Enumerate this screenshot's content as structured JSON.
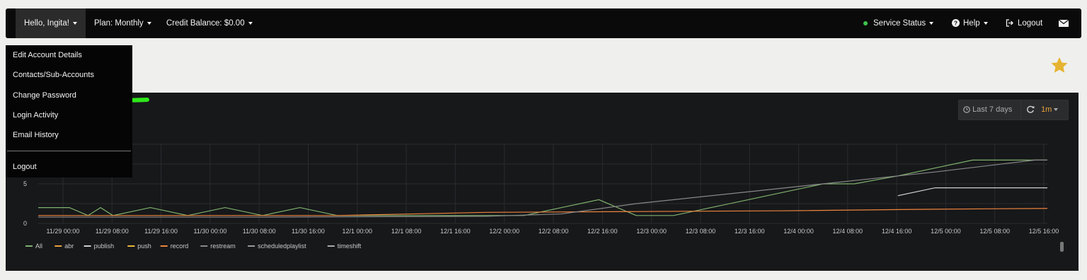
{
  "navbar": {
    "greeting": "Hello, Ingita!",
    "plan": "Plan: Monthly",
    "credit": "Credit Balance: $0.00",
    "service_status": "Service Status",
    "help": "Help",
    "logout": "Logout"
  },
  "account_menu": {
    "items": [
      "Edit Account Details",
      "Contacts/Sub-Accounts",
      "Change Password",
      "Login Activity",
      "Email History"
    ],
    "logout": "Logout"
  },
  "chart_toolbar": {
    "range": "Last 7 days",
    "refresh_interval": "1m"
  },
  "colors": {
    "accent_orange": "#e8a33a",
    "status_green": "#3fc54b",
    "annotation_arrow": "#2ee81a",
    "star": "#e6b432"
  },
  "chart_data": {
    "type": "line",
    "y_ticks": [
      "0",
      "5"
    ],
    "x_ticks": [
      "11/29 00:00",
      "11/29 08:00",
      "11/29 16:00",
      "11/30 00:00",
      "11/30 08:00",
      "11/30 16:00",
      "12/1 00:00",
      "12/1 08:00",
      "12/1 16:00",
      "12/2 00:00",
      "12/2 08:00",
      "12/2 16:00",
      "12/3 00:00",
      "12/3 08:00",
      "12/3 16:00",
      "12/4 00:00",
      "12/4 08:00",
      "12/4 16:00",
      "12/5 00:00",
      "12/5 08:00",
      "12/5 16:00"
    ],
    "legend": [
      {
        "name": "All",
        "color": "#7eb26d"
      },
      {
        "name": "abr",
        "color": "#e8a33a"
      },
      {
        "name": "publish",
        "color": "#cfcfcf"
      },
      {
        "name": "push",
        "color": "#eab839"
      },
      {
        "name": "record",
        "color": "#ef843c"
      },
      {
        "name": "restream",
        "color": "#888888"
      },
      {
        "name": "scheduledplaylist",
        "color": "#999999"
      },
      {
        "name": "timeshift",
        "color": "#aaaaaa"
      }
    ],
    "series": [
      {
        "name": "All",
        "x": [
          0,
          5,
          8,
          10,
          12,
          18,
          24,
          30,
          36,
          42,
          48,
          54,
          56,
          60,
          72,
          78,
          84,
          90,
          96,
          102,
          108,
          114,
          120,
          126,
          130,
          131,
          138,
          144,
          150,
          156,
          162
        ],
        "values": [
          2,
          2,
          1,
          2,
          1,
          2,
          1,
          2,
          1,
          2,
          1,
          1,
          1,
          1,
          1,
          1,
          2,
          3,
          1,
          1,
          2,
          3,
          4,
          5,
          5,
          5,
          6,
          7,
          8,
          8,
          8
        ]
      },
      {
        "name": "record",
        "x": [
          0,
          24,
          48,
          60,
          72,
          96,
          120,
          144,
          162
        ],
        "values": [
          1,
          1,
          1,
          1.2,
          1.4,
          1.5,
          1.6,
          1.8,
          1.9
        ]
      },
      {
        "name": "restream",
        "x": [
          0,
          36,
          72,
          84,
          96,
          120,
          144,
          160,
          162
        ],
        "values": [
          0.8,
          0.8,
          0.9,
          1.2,
          2.5,
          4.5,
          6.5,
          8.0,
          8.0
        ]
      },
      {
        "name": "publish",
        "x": [
          138,
          144,
          150,
          156,
          162
        ],
        "values": [
          3.5,
          4.5,
          4.5,
          4.5,
          4.5
        ]
      }
    ],
    "ylim": [
      0,
      10
    ]
  }
}
